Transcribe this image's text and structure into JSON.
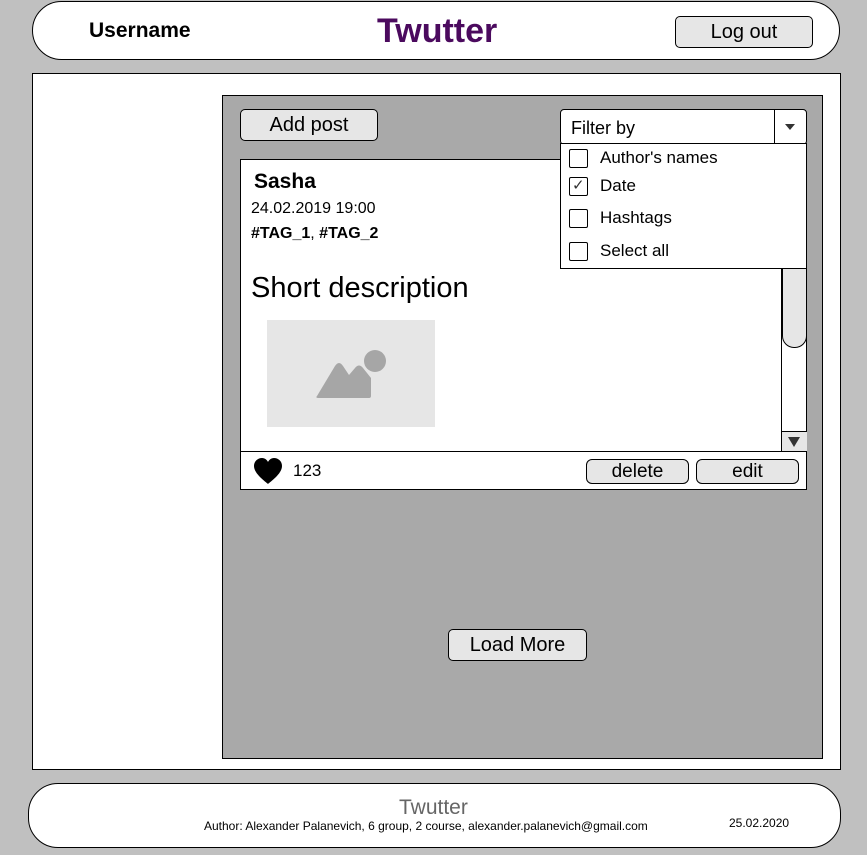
{
  "header": {
    "username": "Username",
    "brand": "Twutter",
    "logout_label": "Log out"
  },
  "toolbar": {
    "add_post_label": "Add post",
    "filter": {
      "label": "Filter by",
      "options": [
        {
          "label": "Author's names",
          "checked": false
        },
        {
          "label": "Date",
          "checked": true
        },
        {
          "label": "Hashtags",
          "checked": false
        },
        {
          "label": "Select all",
          "checked": false
        }
      ]
    }
  },
  "post": {
    "author": "Sasha",
    "date": "24.02.2019 19:00",
    "tags": [
      "#TAG_1",
      "#TAG_2"
    ],
    "tag_separator": ", ",
    "description": "Short description",
    "likes": "123",
    "delete_label": "delete",
    "edit_label": "edit"
  },
  "load_more_label": "Load More",
  "footer": {
    "brand": "Twutter",
    "author_line": "Author: Alexander Palanevich, 6 group, 2 course, alexander.palanevich@gmail.com",
    "date": "25.02.2020"
  },
  "colors": {
    "brand": "#4b0a5e",
    "page_bg": "#c0c0c0",
    "panel_bg": "#a9a9a9",
    "button_bg": "#e6e6e6"
  }
}
